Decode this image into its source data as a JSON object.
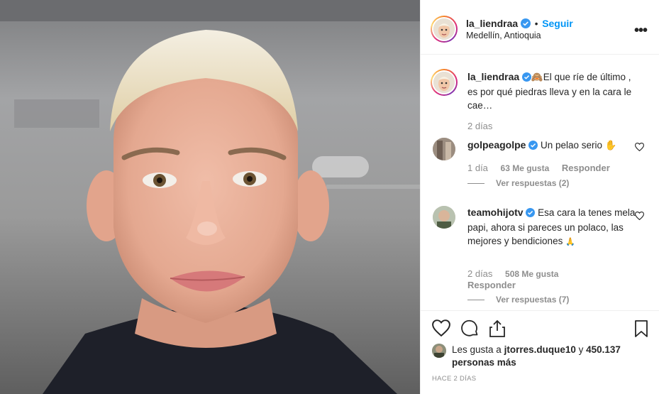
{
  "post": {
    "username": "la_liendraa",
    "separator": "•",
    "follow_label": "Seguir",
    "location": "Medellín, Antioquia",
    "more_label": "•••"
  },
  "caption": {
    "username": "la_liendraa",
    "emoji": "🙈",
    "text": "El que ríe de último , es por qué piedras lleva y en la cara le cae…",
    "time": "2 días"
  },
  "comments": [
    {
      "username": "golpeagolpe",
      "text": "Un pelao serio",
      "emoji": "✋",
      "time": "1 día",
      "likes": "63 Me gusta",
      "reply_label": "Responder",
      "view_replies": "Ver respuestas (2)"
    },
    {
      "username": "teamohijotv",
      "text": "Esa cara la tenes mela papi, ahora si pareces un polaco, las mejores y bendiciones",
      "emoji": "🙏",
      "time": "2 días",
      "likes": "508 Me gusta",
      "reply_label": "Responder",
      "view_replies": "Ver respuestas (7)"
    }
  ],
  "likes": {
    "prefix": "Les gusta a",
    "user": "jtorres.duque10",
    "conj": "y",
    "count": "450.137 personas más"
  },
  "timestamp": "HACE 2 DÍAS",
  "colors": {
    "accent": "#0095f6",
    "text": "#262626",
    "muted": "#8e8e8e",
    "border": "#efefef"
  },
  "icons": [
    "verified-icon",
    "more-icon",
    "heart-icon",
    "comment-icon",
    "share-icon",
    "bookmark-icon"
  ]
}
